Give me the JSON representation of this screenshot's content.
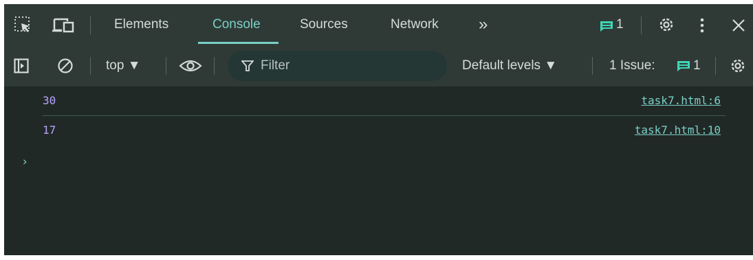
{
  "tabbar": {
    "tabs": [
      {
        "label": "Elements",
        "active": false
      },
      {
        "label": "Console",
        "active": true
      },
      {
        "label": "Sources",
        "active": false
      },
      {
        "label": "Network",
        "active": false
      }
    ],
    "more_tabs_label": "»",
    "messages_count": "1",
    "icons": [
      "select-element-icon",
      "device-toolbar-icon",
      "messages-icon",
      "settings-icon",
      "more-options-icon",
      "close-icon"
    ]
  },
  "toolbar": {
    "context": "top ▼",
    "filter_placeholder": "Filter",
    "levels": "Default levels ▼",
    "issues_label": "1 Issue:",
    "issues_count": "1",
    "icons": [
      "sidebar-toggle-icon",
      "clear-console-icon",
      "eye-icon",
      "filter-icon",
      "issues-icon",
      "console-settings-icon"
    ]
  },
  "console": {
    "messages": [
      {
        "value": "30",
        "source": "task7.html:6"
      },
      {
        "value": "17",
        "source": "task7.html:10"
      }
    ],
    "prompt": "›"
  },
  "colors": {
    "panel_bg": "#212927",
    "toolbar_bg": "#2f3a37",
    "accent": "#7ad0c6",
    "number": "#b7a4ff",
    "text": "#d6dbd9"
  }
}
